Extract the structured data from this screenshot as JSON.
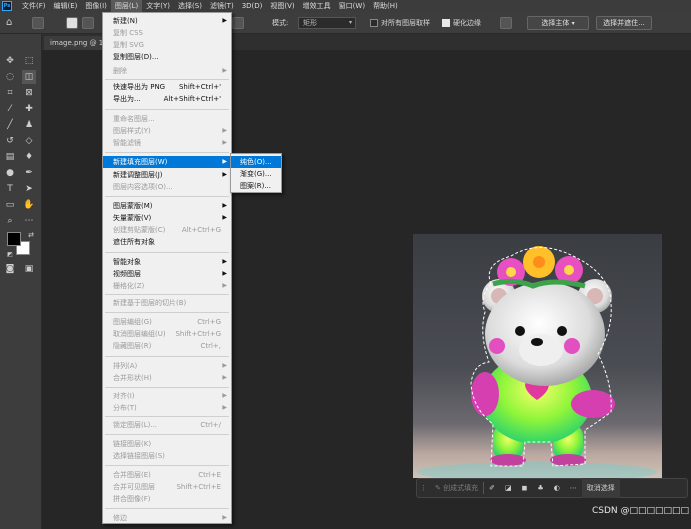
{
  "app": {
    "logo": "Ps"
  },
  "menubar": {
    "items": [
      {
        "label": "文件(F)"
      },
      {
        "label": "编辑(E)"
      },
      {
        "label": "图像(I)"
      },
      {
        "label": "图层(L)"
      },
      {
        "label": "文字(Y)"
      },
      {
        "label": "选择(S)"
      },
      {
        "label": "滤镜(T)"
      },
      {
        "label": "3D(D)"
      },
      {
        "label": "视图(V)"
      },
      {
        "label": "增效工具"
      },
      {
        "label": "窗口(W)"
      },
      {
        "label": "帮助(H)"
      }
    ],
    "active_index": 3
  },
  "options": {
    "mode_label": "模式:",
    "mode_value": "矩形",
    "sample_all_layers": "对所有图层取样",
    "sample_all_checked": false,
    "harden_edges": "硬化边缘",
    "harden_checked": true,
    "select_subject": "选择主体",
    "select_and_mask": "选择并遮住..."
  },
  "document": {
    "tab_title": "image.png @ 10"
  },
  "layer_menu": {
    "items": [
      {
        "label": "新建(N)",
        "shortcut": "",
        "submenu": true,
        "disabled": false
      },
      {
        "label": "复制 CSS",
        "shortcut": "",
        "submenu": false,
        "disabled": true
      },
      {
        "label": "复制 SVG",
        "shortcut": "",
        "submenu": false,
        "disabled": true
      },
      {
        "label": "复制图层(D)...",
        "shortcut": "",
        "submenu": false,
        "disabled": false
      },
      {
        "label": "删除",
        "shortcut": "",
        "submenu": true,
        "disabled": true
      },
      {
        "label": "快速导出为 PNG",
        "shortcut": "Shift+Ctrl+'",
        "submenu": false,
        "disabled": false
      },
      {
        "label": "导出为...",
        "shortcut": "Alt+Shift+Ctrl+'",
        "submenu": false,
        "disabled": false
      },
      {
        "label": "重命名图层...",
        "shortcut": "",
        "submenu": false,
        "disabled": true
      },
      {
        "label": "图层样式(Y)",
        "shortcut": "",
        "submenu": true,
        "disabled": true
      },
      {
        "label": "智能滤镜",
        "shortcut": "",
        "submenu": true,
        "disabled": true
      },
      {
        "label": "新建填充图层(W)",
        "shortcut": "",
        "submenu": true,
        "disabled": false,
        "highlighted": true
      },
      {
        "label": "新建调整图层(J)",
        "shortcut": "",
        "submenu": true,
        "disabled": false
      },
      {
        "label": "图层内容选项(O)...",
        "shortcut": "",
        "submenu": false,
        "disabled": true
      },
      {
        "label": "图层蒙版(M)",
        "shortcut": "",
        "submenu": true,
        "disabled": false
      },
      {
        "label": "矢量蒙版(V)",
        "shortcut": "",
        "submenu": true,
        "disabled": false
      },
      {
        "label": "创建剪贴蒙版(C)",
        "shortcut": "Alt+Ctrl+G",
        "submenu": false,
        "disabled": true
      },
      {
        "label": "遮住所有对象",
        "shortcut": "",
        "submenu": false,
        "disabled": false
      },
      {
        "label": "智能对象",
        "shortcut": "",
        "submenu": true,
        "disabled": false
      },
      {
        "label": "视频图层",
        "shortcut": "",
        "submenu": true,
        "disabled": false
      },
      {
        "label": "栅格化(Z)",
        "shortcut": "",
        "submenu": true,
        "disabled": true
      },
      {
        "label": "新建基于图层的切片(B)",
        "shortcut": "",
        "submenu": false,
        "disabled": true
      },
      {
        "label": "图层编组(G)",
        "shortcut": "Ctrl+G",
        "submenu": false,
        "disabled": true
      },
      {
        "label": "取消图层编组(U)",
        "shortcut": "Shift+Ctrl+G",
        "submenu": false,
        "disabled": true
      },
      {
        "label": "隐藏图层(R)",
        "shortcut": "Ctrl+,",
        "submenu": false,
        "disabled": true
      },
      {
        "label": "排列(A)",
        "shortcut": "",
        "submenu": true,
        "disabled": true
      },
      {
        "label": "合并形状(H)",
        "shortcut": "",
        "submenu": true,
        "disabled": true
      },
      {
        "label": "对齐(I)",
        "shortcut": "",
        "submenu": true,
        "disabled": true
      },
      {
        "label": "分布(T)",
        "shortcut": "",
        "submenu": true,
        "disabled": true
      },
      {
        "label": "锁定图层(L)...",
        "shortcut": "Ctrl+/",
        "submenu": false,
        "disabled": true
      },
      {
        "label": "链接图层(K)",
        "shortcut": "",
        "submenu": false,
        "disabled": true
      },
      {
        "label": "选择链接图层(S)",
        "shortcut": "",
        "submenu": false,
        "disabled": true
      },
      {
        "label": "合并图层(E)",
        "shortcut": "Ctrl+E",
        "submenu": false,
        "disabled": true
      },
      {
        "label": "合并可见图层",
        "shortcut": "Shift+Ctrl+E",
        "submenu": false,
        "disabled": true
      },
      {
        "label": "拼合图像(F)",
        "shortcut": "",
        "submenu": false,
        "disabled": true
      },
      {
        "label": "修边",
        "shortcut": "",
        "submenu": true,
        "disabled": true
      }
    ]
  },
  "fill_submenu": {
    "items": [
      {
        "label": "纯色(O)...",
        "highlighted": true
      },
      {
        "label": "渐变(G)...",
        "highlighted": false
      },
      {
        "label": "图案(R)...",
        "highlighted": false
      }
    ]
  },
  "taskbar": {
    "generative_fill": "创成式填充",
    "deselect": "取消选择"
  },
  "watermark": "CSDN @□□□□□□□",
  "colors": {
    "menu_highlight": "#0078d7",
    "foreground": "#000000",
    "background": "#ffffff"
  }
}
